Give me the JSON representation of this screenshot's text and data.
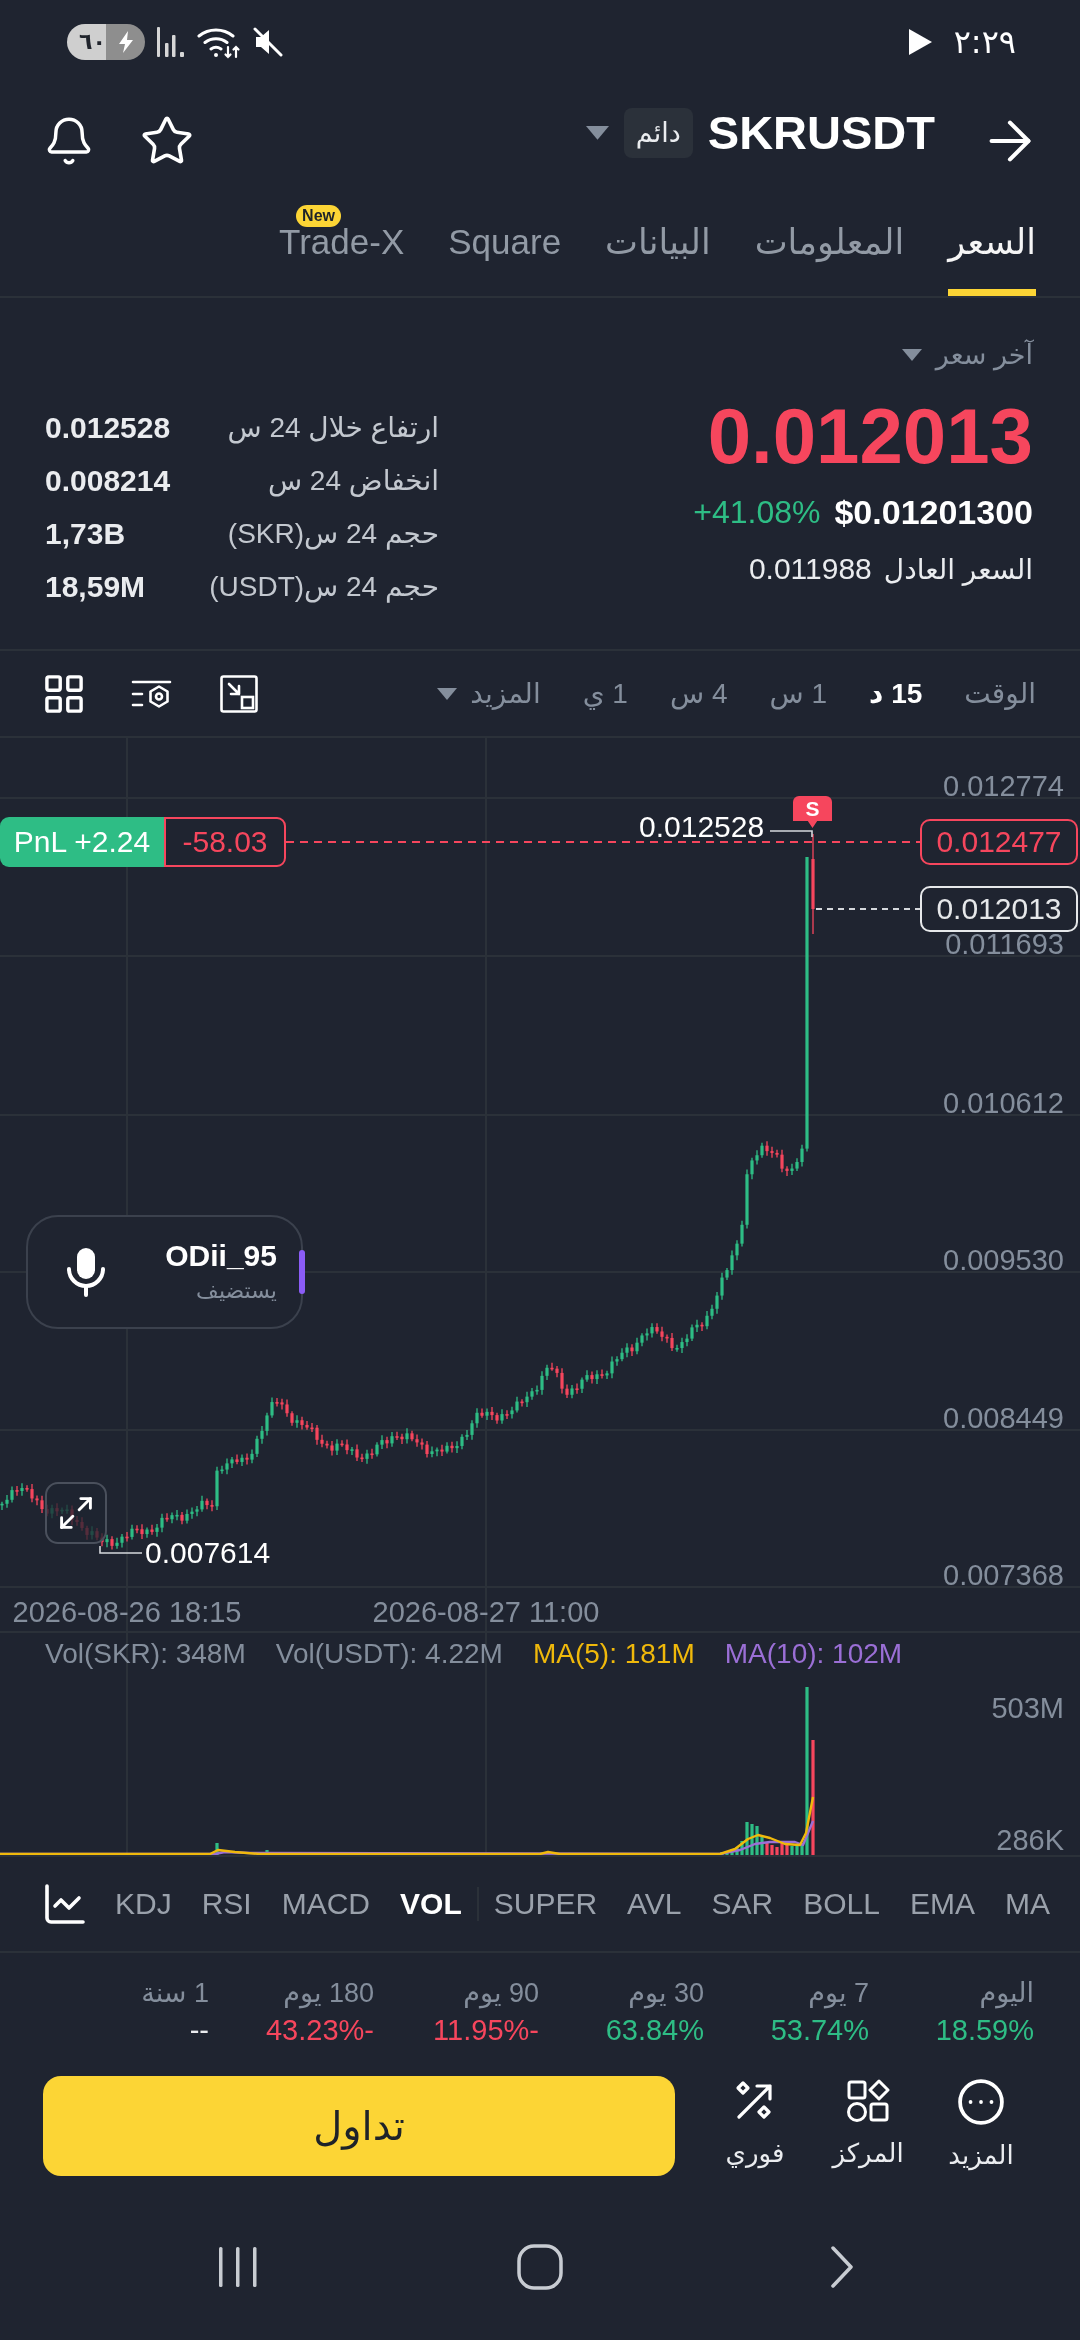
{
  "status_bar": {
    "battery": "٦٠",
    "time": "٢:٢٩"
  },
  "header": {
    "symbol": "SKRUSDT",
    "contract_type": "دائم"
  },
  "tabs": [
    {
      "label": "السعر",
      "selected": true
    },
    {
      "label": "المعلومات",
      "selected": false
    },
    {
      "label": "البيانات",
      "selected": false
    },
    {
      "label": "Square",
      "selected": false
    },
    {
      "label": "Trade-X",
      "selected": false,
      "badge": "New"
    }
  ],
  "price": {
    "selector": "آخر سعر",
    "last": "0.012013",
    "usd": "$0.01201300",
    "change": "+41.08%",
    "fair_label": "السعر العادل",
    "fair_value": "0.011988"
  },
  "stats": [
    {
      "label": "ارتفاع خلال 24 س",
      "value": "0.012528"
    },
    {
      "label": "انخفاض 24 س",
      "value": "0.008214"
    },
    {
      "label": "حجم 24 س(SKR)",
      "value": "1,73B"
    },
    {
      "label": "حجم 24 س(USDT)",
      "value": "18,59M"
    }
  ],
  "intervals": {
    "label": "الوقت",
    "options": [
      {
        "label": "15 د",
        "selected": true
      },
      {
        "label": "1 س",
        "selected": false
      },
      {
        "label": "4 س",
        "selected": false
      },
      {
        "label": "1 ي",
        "selected": false
      }
    ],
    "more": "المزيد"
  },
  "chart": {
    "price_axis": [
      "0.012774",
      "0.011693",
      "0.010612",
      "0.009530",
      "0.008449",
      "0.007368"
    ],
    "time_axis": [
      "2026-08-27 11:00",
      "2026-08-26 18:15"
    ],
    "last_price": "0.012013",
    "position": {
      "entry_price": "0.012477",
      "value": "-58.03",
      "pnl": "PnL +2.24"
    },
    "signal": "S",
    "high_label": "0.012528",
    "low_label": "0.007614"
  },
  "voice_room": {
    "name": "ODii_95",
    "role": "يستضيف"
  },
  "volume": {
    "legend": [
      {
        "text": "MA(10): 102M",
        "color": "#9b6fd6"
      },
      {
        "text": "MA(5): 181M",
        "color": "#f0b90b"
      },
      {
        "text": "Vol(USDT): 4.22M",
        "color": "#848e9c"
      },
      {
        "text": "Vol(SKR): 348M",
        "color": "#848e9c"
      }
    ],
    "axis": [
      "503M",
      "286K"
    ]
  },
  "indicators": [
    {
      "label": "MA",
      "selected": false
    },
    {
      "label": "EMA",
      "selected": false
    },
    {
      "label": "BOLL",
      "selected": false
    },
    {
      "label": "SAR",
      "selected": false
    },
    {
      "label": "AVL",
      "selected": false
    },
    {
      "label": "SUPER",
      "selected": false
    },
    {
      "label": "VOL",
      "selected": true
    },
    {
      "label": "MACD",
      "selected": false
    },
    {
      "label": "RSI",
      "selected": false
    },
    {
      "label": "KDJ",
      "selected": false
    }
  ],
  "returns": [
    {
      "period": "اليوم",
      "value": "18.59%",
      "color": "#2ebd85"
    },
    {
      "period": "7 يوم",
      "value": "53.74%",
      "color": "#2ebd85"
    },
    {
      "period": "30 يوم",
      "value": "63.84%",
      "color": "#2ebd85"
    },
    {
      "period": "90 يوم",
      "value": "-11.95%",
      "color": "#f6465d"
    },
    {
      "period": "180 يوم",
      "value": "-43.23%",
      "color": "#f6465d"
    },
    {
      "period": "1 سنة",
      "value": "--",
      "color": "#eaecef"
    }
  ],
  "actions": {
    "trade": "تداول",
    "shortcuts": [
      {
        "label": "المزيد",
        "kind": "more"
      },
      {
        "label": "المركز",
        "kind": "hub"
      },
      {
        "label": "فوري",
        "kind": "convert"
      }
    ]
  }
}
